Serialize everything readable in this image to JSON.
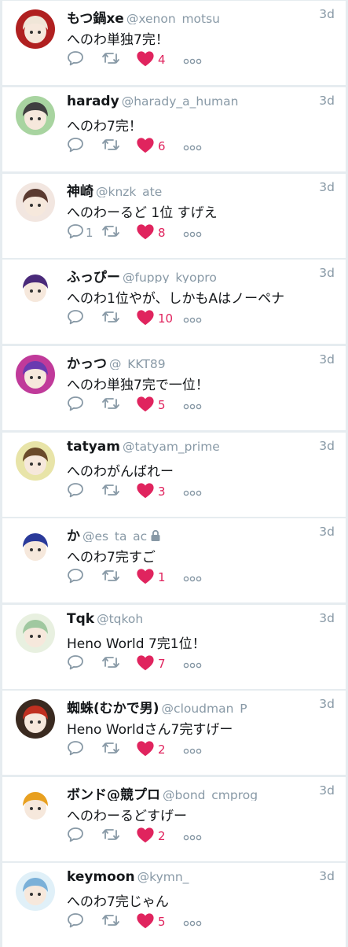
{
  "colors": {
    "like": "#e0245e",
    "meta": "#8899a6",
    "text": "#14171a",
    "bg": "#e6ecf0"
  },
  "tweets": [
    {
      "name": "もつ鍋xe",
      "handle": "@xenon_motsu",
      "time": "3d",
      "text": "へのわ単独7完！",
      "replies": "",
      "likes": "4",
      "locked": false,
      "avatar": {
        "bg": "#b02020",
        "fg": "#f0e6d8"
      }
    },
    {
      "name": "harady",
      "handle": "@harady_a_human",
      "time": "3d",
      "text": "へのわ7完！",
      "replies": "",
      "likes": "6",
      "locked": false,
      "avatar": {
        "bg": "#a8d4a0",
        "fg": "#404040"
      }
    },
    {
      "name": "神崎",
      "handle": "@knzk_ate",
      "time": "3d",
      "text": "へのわーるど 1位 すげえ",
      "replies": "1",
      "likes": "8",
      "locked": false,
      "avatar": {
        "bg": "#f2e6e0",
        "fg": "#5a3a30"
      }
    },
    {
      "name": "ふっぴー",
      "handle": "@fuppy_kyopro",
      "time": "3d",
      "text": "へのわ1位やが、しかもAはノーペナ",
      "replies": "",
      "likes": "10",
      "locked": false,
      "avatar": {
        "bg": "#ffffff",
        "fg": "#4a2a7a"
      }
    },
    {
      "name": "かっつ",
      "handle": "@_KKT89",
      "time": "3d",
      "text": "へのわ単独7完で一位！",
      "replies": "",
      "likes": "5",
      "locked": false,
      "avatar": {
        "bg": "#c03a9a",
        "fg": "#6a3ab0"
      }
    },
    {
      "name": "tatyam",
      "handle": "@tatyam_prime",
      "time": "3d",
      "text": "へのわがんばれー",
      "replies": "",
      "likes": "3",
      "locked": false,
      "avatar": {
        "bg": "#e8e4a8",
        "fg": "#6a4a2a"
      }
    },
    {
      "name": "か",
      "handle": "@es_ta_ac",
      "time": "3d",
      "text": "へのわ7完すご",
      "replies": "",
      "likes": "1",
      "locked": true,
      "avatar": {
        "bg": "#ffffff",
        "fg": "#2a3a9a"
      }
    },
    {
      "name": "Tqk",
      "handle": "@tqkoh",
      "time": "3d",
      "text": "Heno World 7完1位！",
      "replies": "",
      "likes": "7",
      "locked": false,
      "avatar": {
        "bg": "#e8f0e0",
        "fg": "#a0c8a0"
      }
    },
    {
      "name": "蜘蛛(むかで男)",
      "handle": "@cloudman_P",
      "time": "3d",
      "text": "Heno Worldさん7完すげー",
      "replies": "",
      "likes": "2",
      "locked": false,
      "avatar": {
        "bg": "#3a2a20",
        "fg": "#c03020"
      }
    },
    {
      "name": "ボンド@競プロ",
      "handle": "@bond_cmprog",
      "time": "3d",
      "text": "へのわーるどすげー",
      "replies": "",
      "likes": "2",
      "locked": false,
      "avatar": {
        "bg": "#ffffff",
        "fg": "#e8a020"
      }
    },
    {
      "name": "keymoon",
      "handle": "@kymn_",
      "time": "3d",
      "text": "へのわ7完じゃん",
      "replies": "",
      "likes": "5",
      "locked": false,
      "avatar": {
        "bg": "#e0f0f8",
        "fg": "#7ab0d8"
      }
    }
  ]
}
